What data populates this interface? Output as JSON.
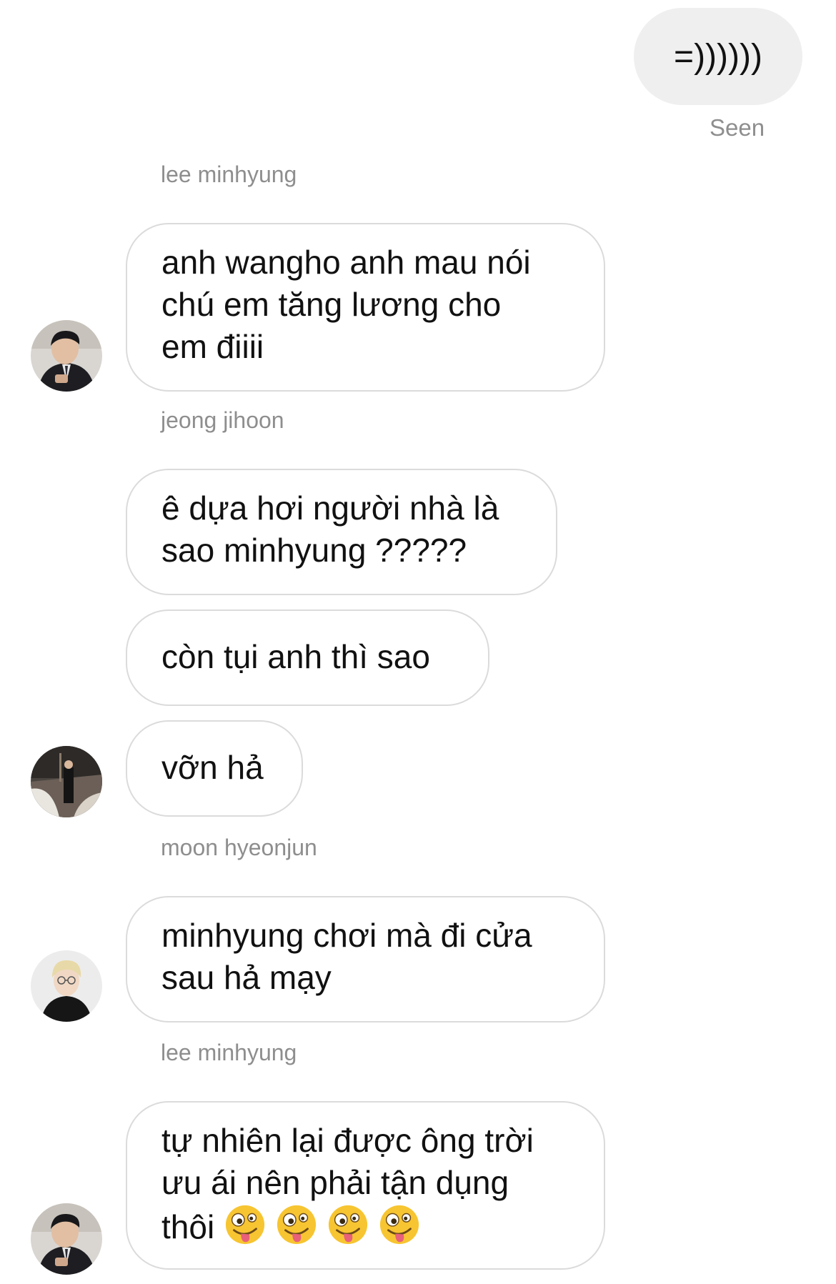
{
  "sent": {
    "text": "=))))))",
    "status": "Seen"
  },
  "messages": [
    {
      "sender": "lee minhyung",
      "lines": [
        "anh wangho anh mau nói",
        "chú em tăng lương cho",
        "em điiii"
      ]
    },
    {
      "sender": "jeong jihoon",
      "lines": [
        "ê dựa hơi người nhà là",
        "sao minhyung ?????"
      ]
    },
    {
      "lines": [
        "còn tụi anh thì sao"
      ]
    },
    {
      "lines": [
        "vỡn hả"
      ]
    },
    {
      "sender": "moon hyeonjun",
      "lines": [
        "minhyung chơi mà đi cửa",
        "sau hả mạy"
      ]
    },
    {
      "sender": "lee minhyung",
      "lines": [
        "tự nhiên lại được ông trời",
        "ưu ái nên phải tận dụng",
        "thôi"
      ],
      "emojis": [
        "zany-face-emoji",
        "zany-face-emoji",
        "zany-face-emoji",
        "zany-face-emoji"
      ]
    }
  ],
  "avatars": [
    "avatar-lee-minhyung",
    "avatar-jeong-jihoon",
    "avatar-moon-hyeonjun",
    "avatar-lee-minhyung"
  ],
  "colors": {
    "sent_bubble": "#efefef",
    "bubble_border": "#dbdbdb",
    "meta_text": "#8e8e8e",
    "text": "#111111"
  }
}
